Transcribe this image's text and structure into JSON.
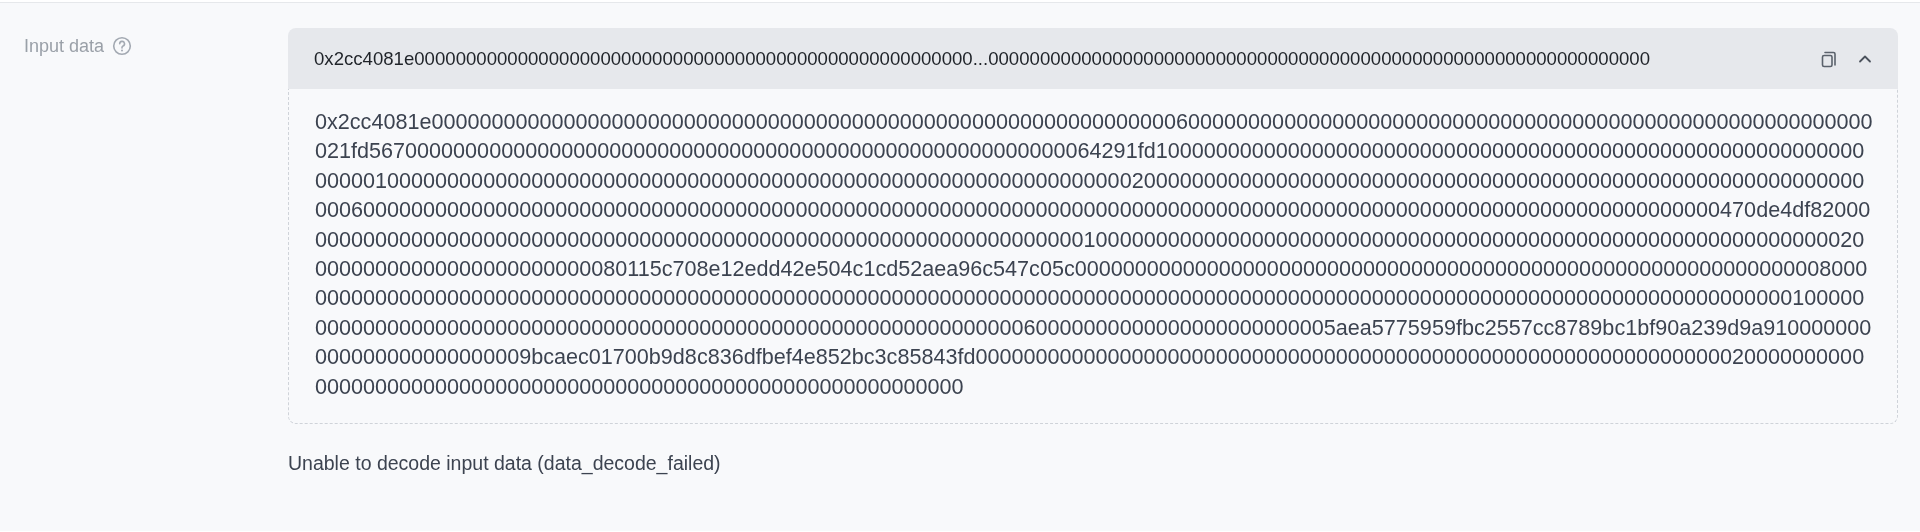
{
  "input_data": {
    "label": "Input data",
    "preview": "0x2cc4081e000000000000000000000000000000000000000000000000000000...0000000000000000000000000000000000000000000000000000000000000000",
    "expanded": true,
    "raw": "0x2cc4081e000000000000000000000000000000000000000000000000000000000000006000000000000000000000000000000000000000000000000000000000021fd5670000000000000000000000000000000000000000000000000000000064291fd10000000000000000000000000000000000000000000000000000000000000001000000000000000000000000000000000000000000000000000000000000002000000000000000000000000000000000000000000000000000000000000000600000000000000000000000000000000000000000000000000000000000000000000000000000000000000000000000000000000000000000470de4df8200000000000000000000000000000000000000000000000000000000000000000001000000000000000000000000000000000000000000000000000000000000002000000000000000000000000080115c708e12edd42e504c1cd52aea96c547c05c0000000000000000000000000000000000000000000000000000000000000080000000000000000000000000000000000000000000000000000000000000000000000000000000000000000000000000000000000000000000000000000001000000000000000000000000000000000000000000000000000000000000000060000000000000000000000005aea5775959fbc2557cc8789bc1bf90a239d9a910000000000000000000000009bcaec01700b9d8c836dfbef4e852bc3c85843fd00000000000000000000000000000000000000000000000000000000000000020000000000000000000000000000000000000000000000000000000000000000",
    "error": "Unable to decode input data (data_decode_failed)"
  }
}
